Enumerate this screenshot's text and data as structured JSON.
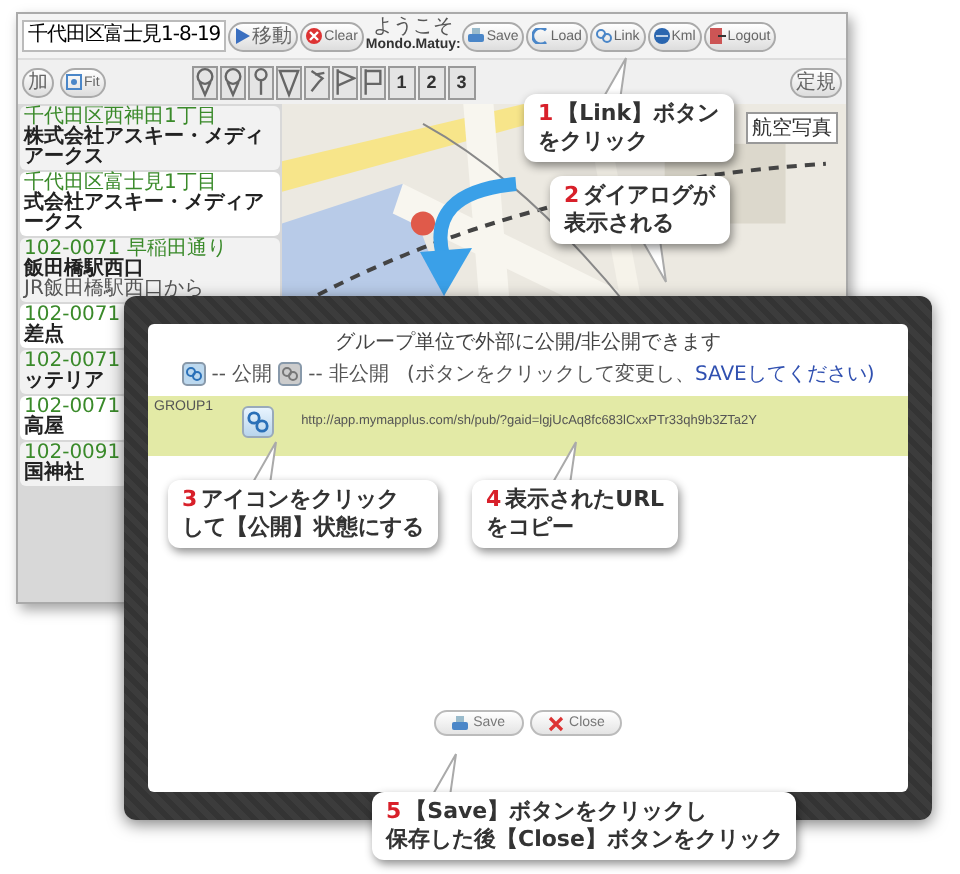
{
  "app_window": {
    "address": "千代田区富士見1-8-19",
    "toolbar": [
      {
        "kind": "move",
        "label": "移動"
      },
      {
        "kind": "clear",
        "label": "Clear"
      },
      {
        "kind": "welcome",
        "label": "ようこそ",
        "user": "Mondo.Matuy:"
      },
      {
        "kind": "save",
        "label": "Save"
      },
      {
        "kind": "load",
        "label": "Load"
      },
      {
        "kind": "link",
        "label": "Link"
      },
      {
        "kind": "kml",
        "label": "Kml"
      },
      {
        "kind": "logout",
        "label": "Logout"
      }
    ],
    "left_buttons": [
      {
        "kind": "plain",
        "label": "加"
      },
      {
        "kind": "fit",
        "label": "Fit"
      }
    ],
    "markers": [
      {
        "kind": "pin"
      },
      {
        "kind": "pin"
      },
      {
        "kind": "needle"
      },
      {
        "kind": "triangle"
      },
      {
        "kind": "pushpin"
      },
      {
        "kind": "flag"
      },
      {
        "kind": "flag_outline"
      },
      {
        "kind": "number",
        "label": "1"
      },
      {
        "kind": "number",
        "label": "2"
      },
      {
        "kind": "number",
        "label": "3"
      }
    ],
    "ruler_button": "定規",
    "map": {
      "aerial_button": "航空写真"
    },
    "sidebar": {
      "items": [
        {
          "address": "千代田区西神田1丁目",
          "title": "株式会社アスキー・メディアークス"
        },
        {
          "address": "千代田区富士見1丁目",
          "title": "式会社アスキー・メディアークス"
        },
        {
          "address": "102-0071 早稲田通り",
          "title": "飯田橋駅西口",
          "note": "JR飯田橋駅西口から"
        },
        {
          "address": "102-0071",
          "title": "差点"
        },
        {
          "address": "102-0071",
          "title": "ッテリア"
        },
        {
          "address": "102-0071",
          "title": "高屋"
        },
        {
          "address": "102-0091",
          "title": "国神社"
        }
      ]
    }
  },
  "dialog": {
    "heading": "グループ単位で外部に公開/非公開できます",
    "legend": {
      "public_label": "-- 公開",
      "private_label": "-- 非公開",
      "hint": "(ボタンをクリックして変更し、",
      "hint_link": "SAVEしてください)"
    },
    "groups": [
      {
        "name": "GROUP1",
        "public": true,
        "url": "http://app.mymapplus.com/sh/pub/?gaid=lgjUcAq8fc683lCxxPTr33qh9b3ZTa2Y"
      }
    ],
    "buttons": [
      {
        "kind": "save",
        "label": "Save"
      },
      {
        "kind": "close",
        "label": "Close"
      }
    ]
  },
  "callouts": [
    {
      "number": "1",
      "lines": [
        "【Link】ボタン",
        "をクリック"
      ]
    },
    {
      "number": "2",
      "lines": [
        "ダイアログが",
        "表示される"
      ]
    },
    {
      "number": "3",
      "lines": [
        "アイコンをクリック",
        "して【公開】状態にする"
      ]
    },
    {
      "number": "4",
      "lines": [
        "表示されたURL",
        "をコピー"
      ]
    },
    {
      "number": "5",
      "lines": [
        "【Save】ボタンをクリックし",
        "保存した後【Close】ボタンをクリック"
      ]
    }
  ]
}
